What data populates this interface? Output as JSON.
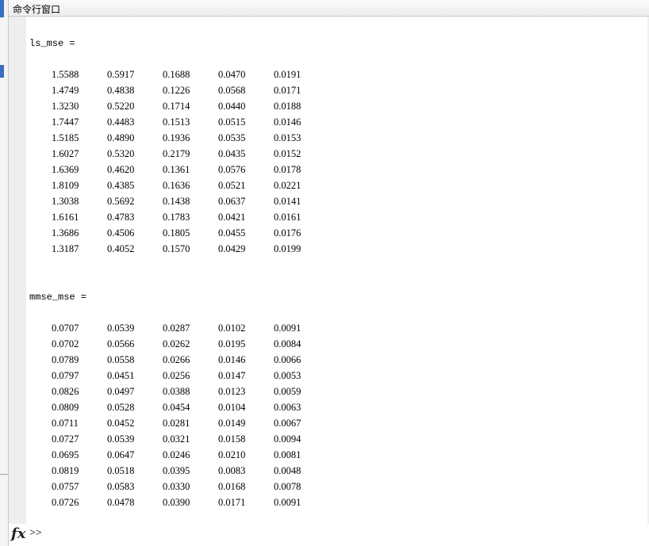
{
  "window": {
    "title": "命令行窗口"
  },
  "command_window": {
    "blocks": [
      {
        "var_label": "ls_mse =",
        "rows": [
          [
            "1.5588",
            "0.5917",
            "0.1688",
            "0.0470",
            "0.0191"
          ],
          [
            "1.4749",
            "0.4838",
            "0.1226",
            "0.0568",
            "0.0171"
          ],
          [
            "1.3230",
            "0.5220",
            "0.1714",
            "0.0440",
            "0.0188"
          ],
          [
            "1.7447",
            "0.4483",
            "0.1513",
            "0.0515",
            "0.0146"
          ],
          [
            "1.5185",
            "0.4890",
            "0.1936",
            "0.0535",
            "0.0153"
          ],
          [
            "1.6027",
            "0.5320",
            "0.2179",
            "0.0435",
            "0.0152"
          ],
          [
            "1.6369",
            "0.4620",
            "0.1361",
            "0.0576",
            "0.0178"
          ],
          [
            "1.8109",
            "0.4385",
            "0.1636",
            "0.0521",
            "0.0221"
          ],
          [
            "1.3038",
            "0.5692",
            "0.1438",
            "0.0637",
            "0.0141"
          ],
          [
            "1.6161",
            "0.4783",
            "0.1783",
            "0.0421",
            "0.0161"
          ],
          [
            "1.3686",
            "0.4506",
            "0.1805",
            "0.0455",
            "0.0176"
          ],
          [
            "1.3187",
            "0.4052",
            "0.1570",
            "0.0429",
            "0.0199"
          ]
        ]
      },
      {
        "var_label": "mmse_mse =",
        "rows": [
          [
            "0.0707",
            "0.0539",
            "0.0287",
            "0.0102",
            "0.0091"
          ],
          [
            "0.0702",
            "0.0566",
            "0.0262",
            "0.0195",
            "0.0084"
          ],
          [
            "0.0789",
            "0.0558",
            "0.0266",
            "0.0146",
            "0.0066"
          ],
          [
            "0.0797",
            "0.0451",
            "0.0256",
            "0.0147",
            "0.0053"
          ],
          [
            "0.0826",
            "0.0497",
            "0.0388",
            "0.0123",
            "0.0059"
          ],
          [
            "0.0809",
            "0.0528",
            "0.0454",
            "0.0104",
            "0.0063"
          ],
          [
            "0.0711",
            "0.0452",
            "0.0281",
            "0.0149",
            "0.0067"
          ],
          [
            "0.0727",
            "0.0539",
            "0.0321",
            "0.0158",
            "0.0094"
          ],
          [
            "0.0695",
            "0.0647",
            "0.0246",
            "0.0210",
            "0.0081"
          ],
          [
            "0.0819",
            "0.0518",
            "0.0395",
            "0.0083",
            "0.0048"
          ],
          [
            "0.0757",
            "0.0583",
            "0.0330",
            "0.0168",
            "0.0078"
          ],
          [
            "0.0726",
            "0.0478",
            "0.0390",
            "0.0171",
            "0.0091"
          ]
        ]
      }
    ]
  },
  "prompt": {
    "fx_icon": "function-browser-icon",
    "fx_label": "fx",
    "symbol": ">>"
  }
}
